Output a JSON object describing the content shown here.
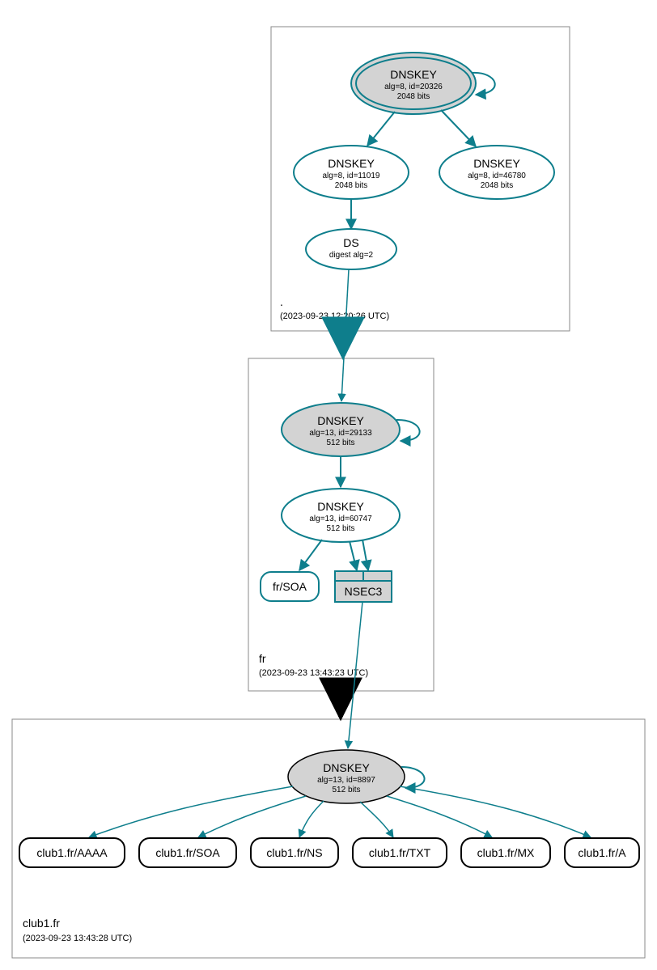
{
  "zones": {
    "root": {
      "name": ".",
      "timestamp": "(2023-09-23 12:20:26 UTC)"
    },
    "fr": {
      "name": "fr",
      "timestamp": "(2023-09-23 13:43:23 UTC)"
    },
    "club1": {
      "name": "club1.fr",
      "timestamp": "(2023-09-23 13:43:28 UTC)"
    }
  },
  "nodes": {
    "root_ksk": {
      "title": "DNSKEY",
      "l2": "alg=8, id=20326",
      "l3": "2048 bits"
    },
    "root_zsk1": {
      "title": "DNSKEY",
      "l2": "alg=8, id=11019",
      "l3": "2048 bits"
    },
    "root_zsk2": {
      "title": "DNSKEY",
      "l2": "alg=8, id=46780",
      "l3": "2048 bits"
    },
    "root_ds": {
      "title": "DS",
      "l2": "digest alg=2"
    },
    "fr_ksk": {
      "title": "DNSKEY",
      "l2": "alg=13, id=29133",
      "l3": "512 bits"
    },
    "fr_zsk": {
      "title": "DNSKEY",
      "l2": "alg=13, id=60747",
      "l3": "512 bits"
    },
    "fr_soa": {
      "title": "fr/SOA"
    },
    "fr_nsec3": {
      "title": "NSEC3"
    },
    "club1_ksk": {
      "title": "DNSKEY",
      "l2": "alg=13, id=8897",
      "l3": "512 bits"
    },
    "rec_aaaa": {
      "title": "club1.fr/AAAA"
    },
    "rec_soa": {
      "title": "club1.fr/SOA"
    },
    "rec_ns": {
      "title": "club1.fr/NS"
    },
    "rec_txt": {
      "title": "club1.fr/TXT"
    },
    "rec_mx": {
      "title": "club1.fr/MX"
    },
    "rec_a": {
      "title": "club1.fr/A"
    }
  }
}
